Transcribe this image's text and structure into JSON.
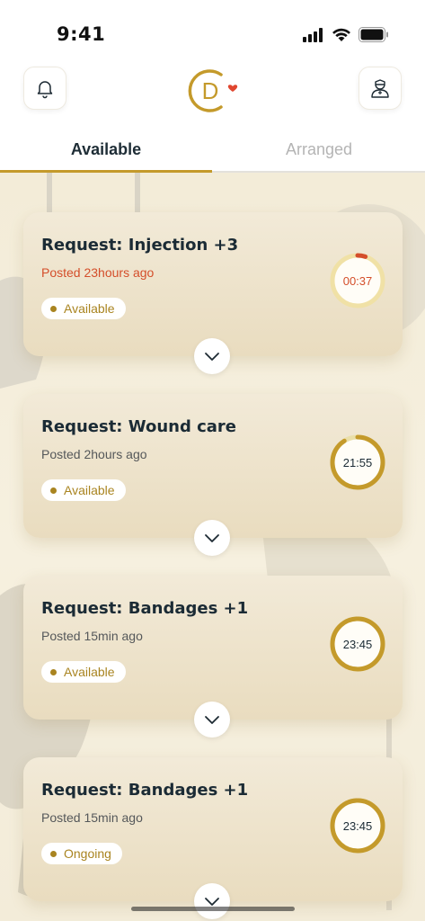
{
  "status_bar": {
    "time": "9:41"
  },
  "header": {
    "bell_icon": "bell-icon",
    "logo_letter": "D",
    "profile_icon": "nurse-profile-icon"
  },
  "tabs": [
    {
      "label": "Available",
      "active": true
    },
    {
      "label": "Arranged",
      "active": false
    }
  ],
  "colors": {
    "accent": "#c49a2b",
    "urgent": "#d44e2a",
    "badge": "#a98420"
  },
  "requests": [
    {
      "title": "Request: Injection +3",
      "posted": "Posted 23hours ago",
      "status": "Available",
      "timer": "00:37",
      "timer_progress": 0.05,
      "urgent": true
    },
    {
      "title": "Request: Wound care",
      "posted": "Posted 2hours ago",
      "status": "Available",
      "timer": "21:55",
      "timer_progress": 0.91,
      "urgent": false
    },
    {
      "title": "Request: Bandages +1",
      "posted": "Posted 15min ago",
      "status": "Available",
      "timer": "23:45",
      "timer_progress": 0.99,
      "urgent": false
    },
    {
      "title": "Request: Bandages +1",
      "posted": "Posted 15min ago",
      "status": "Ongoing",
      "timer": "23:45",
      "timer_progress": 0.99,
      "urgent": false
    }
  ]
}
